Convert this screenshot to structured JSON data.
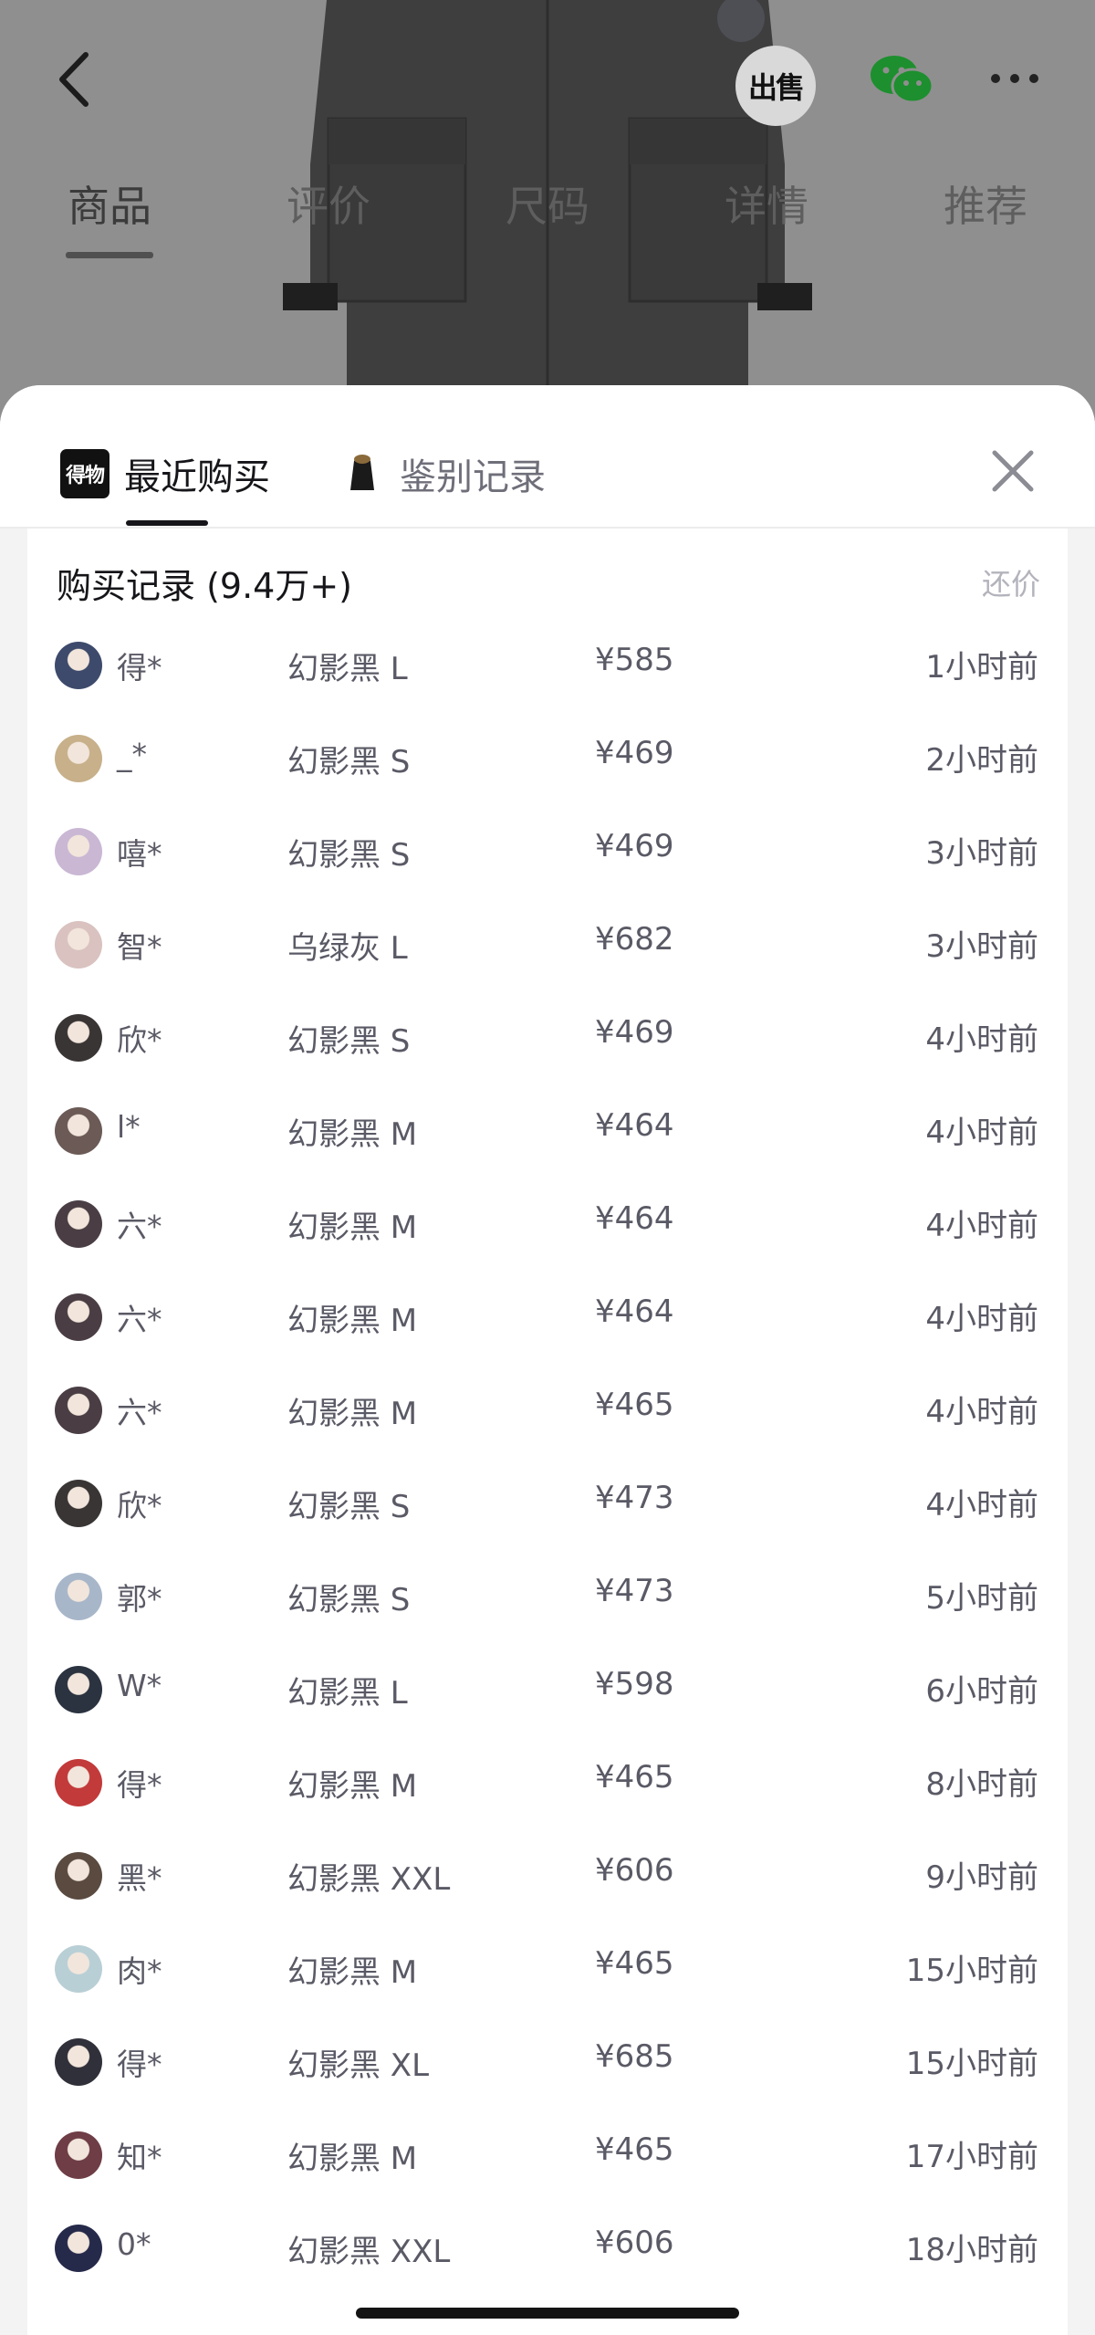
{
  "product_tabs": [
    "商品",
    "评价",
    "尺码",
    "详情",
    "推荐"
  ],
  "actions": {
    "sell_label": "出售"
  },
  "sheet": {
    "tab_recent": "最近购买",
    "tab_auth": "鉴别记录",
    "brand_logo_text": "得物",
    "title": "购买记录 (9.4万+)",
    "counter_offer": "还价"
  },
  "colors": {
    "accent": "#16161a",
    "muted": "#5a5a66",
    "wechat": "#1aad19"
  },
  "records": [
    {
      "user": "得*",
      "sku": "幻影黑 L",
      "price": "¥585",
      "time": "1小时前",
      "avatar": "#3d4a6b"
    },
    {
      "user": "_*",
      "sku": "幻影黑 S",
      "price": "¥469",
      "time": "2小时前",
      "avatar": "#c7b08a"
    },
    {
      "user": "嘻*",
      "sku": "幻影黑 S",
      "price": "¥469",
      "time": "3小时前",
      "avatar": "#c9b7d4"
    },
    {
      "user": "智*",
      "sku": "乌绿灰 L",
      "price": "¥682",
      "time": "3小时前",
      "avatar": "#d9c2c0"
    },
    {
      "user": "欣*",
      "sku": "幻影黑 S",
      "price": "¥469",
      "time": "4小时前",
      "avatar": "#3a3535"
    },
    {
      "user": "l*",
      "sku": "幻影黑 M",
      "price": "¥464",
      "time": "4小时前",
      "avatar": "#6b5a55"
    },
    {
      "user": "六*",
      "sku": "幻影黑 M",
      "price": "¥464",
      "time": "4小时前",
      "avatar": "#4a3e44"
    },
    {
      "user": "六*",
      "sku": "幻影黑 M",
      "price": "¥464",
      "time": "4小时前",
      "avatar": "#4a3e44"
    },
    {
      "user": "六*",
      "sku": "幻影黑 M",
      "price": "¥465",
      "time": "4小时前",
      "avatar": "#4a3e44"
    },
    {
      "user": "欣*",
      "sku": "幻影黑 S",
      "price": "¥473",
      "time": "4小时前",
      "avatar": "#3a3535"
    },
    {
      "user": "郭*",
      "sku": "幻影黑 S",
      "price": "¥473",
      "time": "5小时前",
      "avatar": "#a8b6c9"
    },
    {
      "user": "W*",
      "sku": "幻影黑 L",
      "price": "¥598",
      "time": "6小时前",
      "avatar": "#2b3340"
    },
    {
      "user": "得*",
      "sku": "幻影黑 M",
      "price": "¥465",
      "time": "8小时前",
      "avatar": "#c23a3a"
    },
    {
      "user": "黑*",
      "sku": "幻影黑 XXL",
      "price": "¥606",
      "time": "9小时前",
      "avatar": "#5a4a40"
    },
    {
      "user": "肉*",
      "sku": "幻影黑 M",
      "price": "¥465",
      "time": "15小时前",
      "avatar": "#b9cfd6"
    },
    {
      "user": "得*",
      "sku": "幻影黑 XL",
      "price": "¥685",
      "time": "15小时前",
      "avatar": "#30303a"
    },
    {
      "user": "知*",
      "sku": "幻影黑 M",
      "price": "¥465",
      "time": "17小时前",
      "avatar": "#6e3d45"
    },
    {
      "user": "0*",
      "sku": "幻影黑 XXL",
      "price": "¥606",
      "time": "18小时前",
      "avatar": "#262a4a"
    }
  ]
}
